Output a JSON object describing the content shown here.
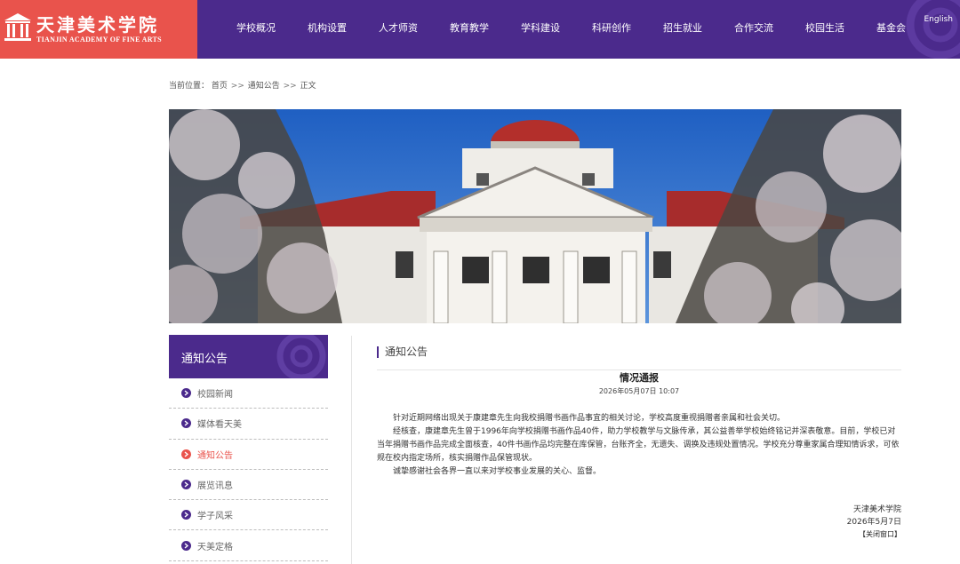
{
  "header": {
    "logo_cn": "天津美术学院",
    "logo_en": "TIANJIN ACADEMY OF FINE ARTS",
    "nav": [
      {
        "label": "学校概况"
      },
      {
        "label": "机构设置"
      },
      {
        "label": "人才师资"
      },
      {
        "label": "教育教学"
      },
      {
        "label": "学科建设"
      },
      {
        "label": "科研创作"
      },
      {
        "label": "招生就业"
      },
      {
        "label": "合作交流"
      },
      {
        "label": "校园生活"
      },
      {
        "label": "基金会"
      }
    ],
    "lang_label": "English"
  },
  "breadcrumb": {
    "prefix": "当前位置：",
    "items": [
      "首页",
      "通知公告",
      "正文"
    ],
    "separator": ">>"
  },
  "sidebar": {
    "title": "通知公告",
    "items": [
      {
        "label": "校园新闻",
        "active": false
      },
      {
        "label": "媒体看天美",
        "active": false
      },
      {
        "label": "通知公告",
        "active": true
      },
      {
        "label": "展览讯息",
        "active": false
      },
      {
        "label": "学子风采",
        "active": false
      },
      {
        "label": "天美定格",
        "active": false
      }
    ]
  },
  "article": {
    "section": "通知公告",
    "title": "情况通报",
    "date": "2026年05月07日 10:07",
    "paragraphs": [
      "针对近期网络出现关于康建章先生向我校捐赠书画作品事宜的相关讨论，学校高度重视捐赠者亲属和社会关切。",
      "经核查，康建章先生曾于1996年向学校捐赠书画作品40件，助力学校教学与文脉传承，其公益善举学校始终铭记并深表敬意。目前，学校已对当年捐赠书画作品完成全面核查，40件书画作品均完整在库保管，台账齐全，无遗失、调换及违规处置情况。学校充分尊重家属合理知情诉求，可依规在校内指定场所，核实捐赠作品保管现状。",
      "诚挚感谢社会各界一直以来对学校事业发展的关心、监督。"
    ],
    "signature": "天津美术学院",
    "sign_date": "2026年5月7日",
    "close_label": "【关闭窗口】"
  },
  "colors": {
    "brand_purple": "#4b2a8c",
    "brand_red": "#e9534c"
  }
}
